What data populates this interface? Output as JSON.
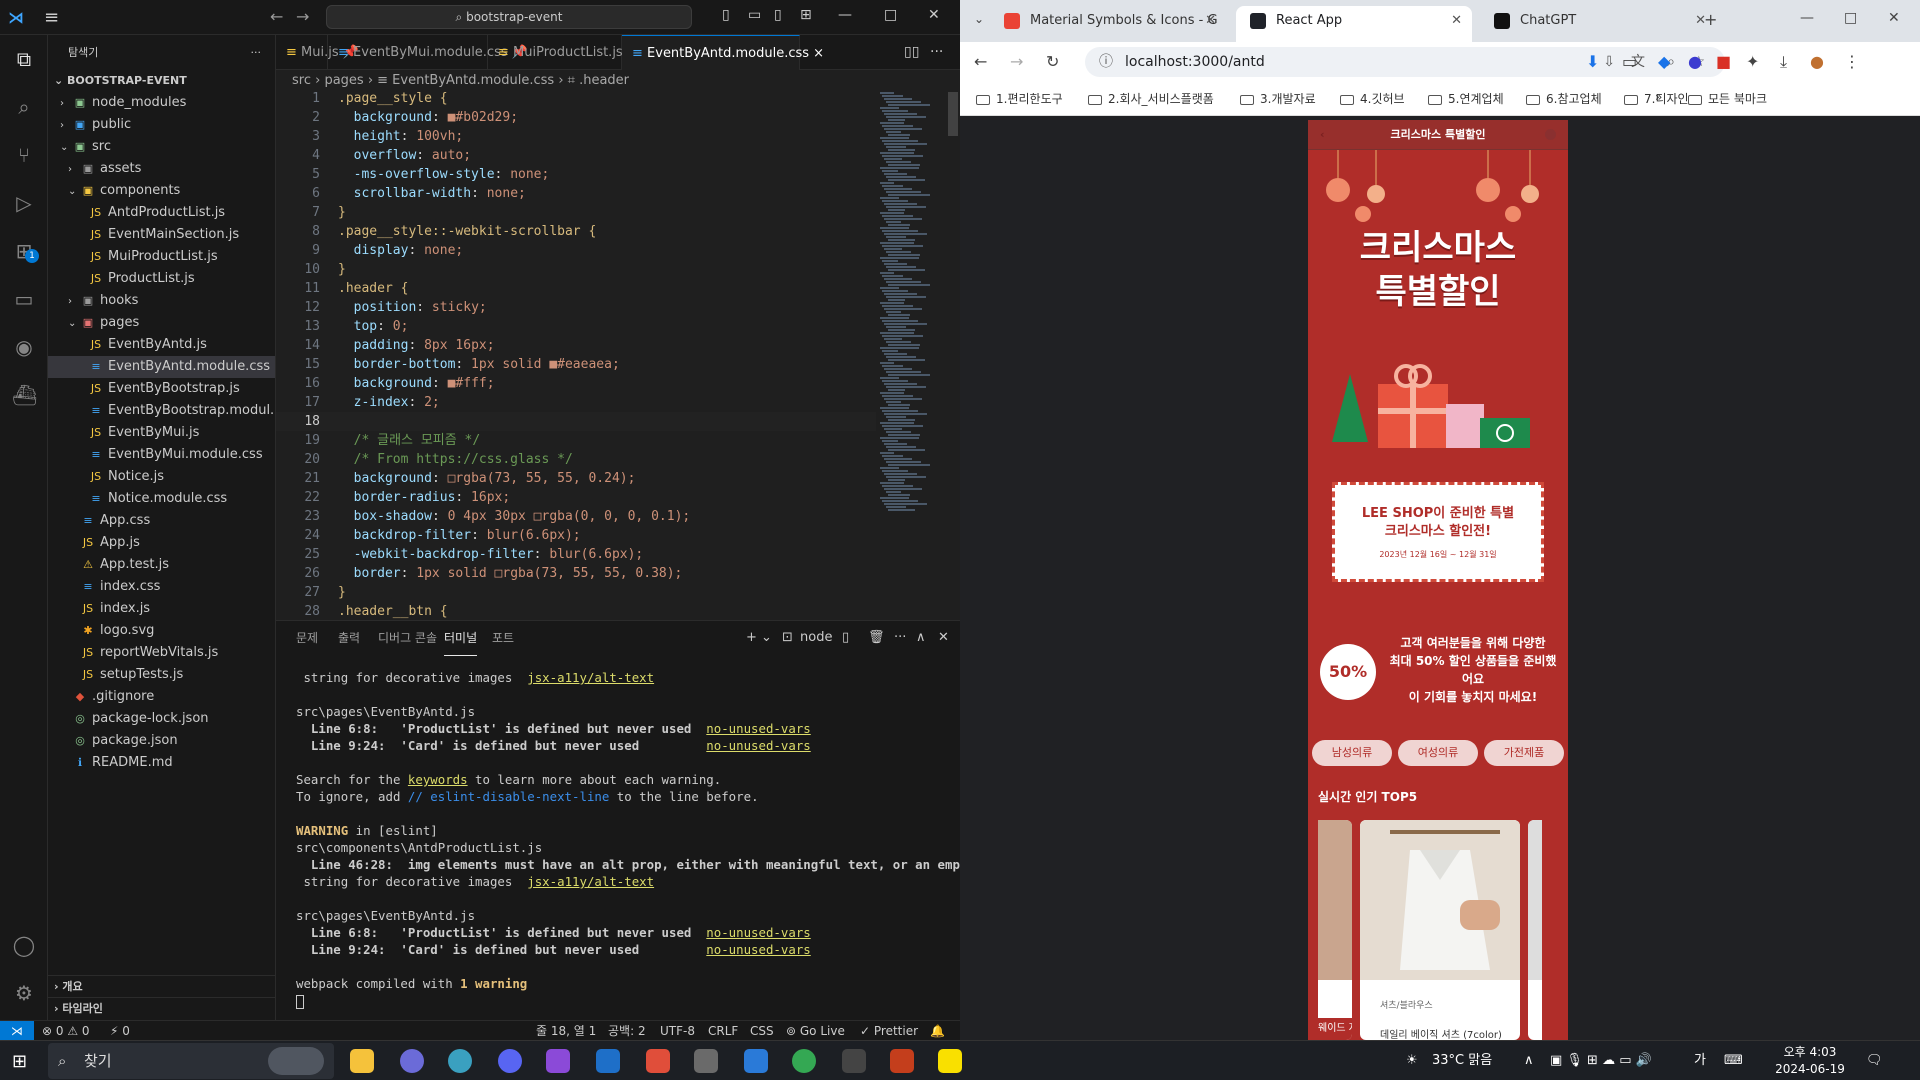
{
  "vscode": {
    "title_search": "bootstrap-event",
    "sidebar": {
      "title": "탐색기",
      "root": "BOOTSTRAP-EVENT",
      "items": [
        {
          "label": "node_modules",
          "chev": "›",
          "icon": "▣",
          "color": "#8dc891",
          "indent": 1
        },
        {
          "label": "public",
          "chev": "›",
          "icon": "▣",
          "color": "#42a5f5",
          "indent": 1
        },
        {
          "label": "src",
          "chev": "⌄",
          "icon": "▣",
          "color": "#8dc891",
          "indent": 1
        },
        {
          "label": "assets",
          "chev": "›",
          "icon": "▣",
          "color": "#9b9b9b",
          "indent": 2
        },
        {
          "label": "components",
          "chev": "⌄",
          "icon": "▣",
          "color": "#f5c842",
          "indent": 2
        },
        {
          "label": "AntdProductList.js",
          "chev": "",
          "icon": "JS",
          "color": "#f5c842",
          "indent": 3
        },
        {
          "label": "EventMainSection.js",
          "chev": "",
          "icon": "JS",
          "color": "#f5c842",
          "indent": 3
        },
        {
          "label": "MuiProductList.js",
          "chev": "",
          "icon": "JS",
          "color": "#f5c842",
          "indent": 3
        },
        {
          "label": "ProductList.js",
          "chev": "",
          "icon": "JS",
          "color": "#f5c842",
          "indent": 3
        },
        {
          "label": "hooks",
          "chev": "›",
          "icon": "▣",
          "color": "#9b9b9b",
          "indent": 2
        },
        {
          "label": "pages",
          "chev": "⌄",
          "icon": "▣",
          "color": "#e57373",
          "indent": 2
        },
        {
          "label": "EventByAntd.js",
          "chev": "",
          "icon": "JS",
          "color": "#f5c842",
          "indent": 3
        },
        {
          "label": "EventByAntd.module.css",
          "chev": "",
          "icon": "≡",
          "color": "#42a5f5",
          "indent": 3,
          "selected": true
        },
        {
          "label": "EventByBootstrap.js",
          "chev": "",
          "icon": "JS",
          "color": "#f5c842",
          "indent": 3
        },
        {
          "label": "EventByBootstrap.modul...",
          "chev": "",
          "icon": "≡",
          "color": "#42a5f5",
          "indent": 3
        },
        {
          "label": "EventByMui.js",
          "chev": "",
          "icon": "JS",
          "color": "#f5c842",
          "indent": 3
        },
        {
          "label": "EventByMui.module.css",
          "chev": "",
          "icon": "≡",
          "color": "#42a5f5",
          "indent": 3
        },
        {
          "label": "Notice.js",
          "chev": "",
          "icon": "JS",
          "color": "#f5c842",
          "indent": 3
        },
        {
          "label": "Notice.module.css",
          "chev": "",
          "icon": "≡",
          "color": "#42a5f5",
          "indent": 3
        },
        {
          "label": "App.css",
          "chev": "",
          "icon": "≡",
          "color": "#42a5f5",
          "indent": 2
        },
        {
          "label": "App.js",
          "chev": "",
          "icon": "JS",
          "color": "#f5c842",
          "indent": 2
        },
        {
          "label": "App.test.js",
          "chev": "",
          "icon": "⚠",
          "color": "#f5c842",
          "indent": 2
        },
        {
          "label": "index.css",
          "chev": "",
          "icon": "≡",
          "color": "#42a5f5",
          "indent": 2
        },
        {
          "label": "index.js",
          "chev": "",
          "icon": "JS",
          "color": "#f5c842",
          "indent": 2
        },
        {
          "label": "logo.svg",
          "chev": "",
          "icon": "✱",
          "color": "#f5a623",
          "indent": 2
        },
        {
          "label": "reportWebVitals.js",
          "chev": "",
          "icon": "JS",
          "color": "#f5c842",
          "indent": 2
        },
        {
          "label": "setupTests.js",
          "chev": "",
          "icon": "JS",
          "color": "#f5c842",
          "indent": 2
        },
        {
          "label": ".gitignore",
          "chev": "",
          "icon": "◆",
          "color": "#e0533b",
          "indent": 1
        },
        {
          "label": "package-lock.json",
          "chev": "",
          "icon": "◎",
          "color": "#8dc891",
          "indent": 1
        },
        {
          "label": "package.json",
          "chev": "",
          "icon": "◎",
          "color": "#8dc891",
          "indent": 1
        },
        {
          "label": "README.md",
          "chev": "",
          "icon": "ℹ",
          "color": "#42a5f5",
          "indent": 1
        }
      ],
      "outline": "개요",
      "timeline": "타임라인"
    },
    "tabs": [
      {
        "label": "Mui.js",
        "icon": "📌",
        "icon_color": "#f5c842"
      },
      {
        "label": "EventByMui.module.css",
        "icon": "📌",
        "icon_color": "#42a5f5"
      },
      {
        "label": "MuiProductList.js",
        "icon": "",
        "icon_color": "#f5c842"
      },
      {
        "label": "EventByAntd.module.css",
        "icon": "×",
        "icon_color": "#42a5f5",
        "active": true
      }
    ],
    "breadcrumb": "src  ›  pages  ›  ≡  EventByAntd.module.css  ›  ⌗ .header",
    "code": [
      ".page__style {",
      "  background: ■#b02d29;",
      "  height: 100vh;",
      "  overflow: auto;",
      "  -ms-overflow-style: none;",
      "  scrollbar-width: none;",
      "}",
      ".page__style::-webkit-scrollbar {",
      "  display: none;",
      "}",
      ".header {",
      "  position: sticky;",
      "  top: 0;",
      "  padding: 8px 16px;",
      "  border-bottom: 1px solid ■#eaeaea;",
      "  background: ■#fff;",
      "  z-index: 2;",
      "",
      "  /* 글래스 모피즘 */",
      "  /* From https://css.glass */",
      "  background: □rgba(73, 55, 55, 0.24);",
      "  border-radius: 16px;",
      "  box-shadow: 0 4px 30px □rgba(0, 0, 0, 0.1);",
      "  backdrop-filter: blur(6.6px);",
      "  -webkit-backdrop-filter: blur(6.6px);",
      "  border: 1px solid □rgba(73, 55, 55, 0.38);",
      "}",
      ".header__btn {"
    ],
    "current_line": 18,
    "panel_tabs": [
      "문제",
      "출력",
      "디버그 콘솔",
      "터미널",
      "포트"
    ],
    "active_panel": "터미널",
    "terminal_label": "node",
    "terminal": [
      {
        "t": " string for decorative images  ",
        "link": "jsx-a11y/alt-text"
      },
      {
        "t": ""
      },
      {
        "t": "src\\pages\\EventByAntd.js"
      },
      {
        "t": "  Line 6:8:   'ProductList' is defined but never used  ",
        "link": "no-unused-vars",
        "bold_prefix": true
      },
      {
        "t": "  Line 9:24:  'Card' is defined but never used         ",
        "link": "no-unused-vars",
        "bold_prefix": true
      },
      {
        "t": ""
      },
      {
        "t": "Search for the ",
        "link": "keywords",
        "after": " to learn more about each warning."
      },
      {
        "t": "To ignore, add ",
        "blue": "// eslint-disable-next-line",
        "after": " to the line before."
      },
      {
        "t": ""
      },
      {
        "warn": "WARNING",
        "t": " in [eslint]"
      },
      {
        "t": "src\\components\\AntdProductList.js"
      },
      {
        "t": "  Line 46:28:  img elements must have an alt prop, either with meaningful text, or an empty",
        "bold_prefix": true
      },
      {
        "t": " string for decorative images  ",
        "link": "jsx-a11y/alt-text"
      },
      {
        "t": ""
      },
      {
        "t": "src\\pages\\EventByAntd.js"
      },
      {
        "t": "  Line 6:8:   'ProductList' is defined but never used  ",
        "link": "no-unused-vars",
        "bold_prefix": true
      },
      {
        "t": "  Line 9:24:  'Card' is defined but never used         ",
        "link": "no-unused-vars",
        "bold_prefix": true
      },
      {
        "t": ""
      },
      {
        "t": "webpack compiled with ",
        "warnword": "1 warning"
      }
    ],
    "status": {
      "errors": "⊗ 0 ⚠ 0",
      "ports": "⚡ 0",
      "position": "줄 18, 열 1",
      "spaces": "공백: 2",
      "encoding": "UTF-8",
      "eol": "CRLF",
      "language": "CSS",
      "golive": "⊚ Go Live",
      "prettier": "✓ Prettier"
    }
  },
  "chrome": {
    "tabs": [
      {
        "label": "Material Symbols & Icons - G",
        "fav": "#ea4335"
      },
      {
        "label": "React App",
        "fav": "#20232a",
        "active": true
      },
      {
        "label": "ChatGPT",
        "fav": "#111111"
      }
    ],
    "url": "localhost:3000/antd",
    "bookmarks": [
      "1.편리한도구",
      "2.회사_서비스플랫폼",
      "3.개발자료",
      "4.깃허브",
      "5.연계업체",
      "6.참고업체",
      "7.디자인"
    ],
    "bookmarks_more": "»",
    "bookmarks_all": "모든 북마크"
  },
  "app": {
    "header_title": "크리스마스 특별할인",
    "hero_title_1": "크리스마스",
    "hero_title_2": "특별할인",
    "notice_line1": "LEE SHOP이 준비한 특별",
    "notice_line2": "크리스마스 할인전!",
    "notice_date": "2023년 12월 16일 ~ 12월 31일",
    "badge": "50%",
    "promo": [
      "고객 여러분들을 위해 다양한",
      "최대 50% 할인 상품들을 준비했",
      "어요",
      "이 기회를 놓치지 마세요!"
    ],
    "categories": [
      "남성의류",
      "여성의류",
      "가전제품"
    ],
    "section_title": "실시간 인기 TOP5",
    "product_category": "셔츠/블라우스",
    "product_name": "데일리 베이직 셔츠 (7color)",
    "prev_product_name": "웨이드 자"
  },
  "taskbar": {
    "search": "찾기",
    "weather": "33°C 맑음",
    "time": "오후 4:03",
    "date": "2024-06-19",
    "ime": "가"
  }
}
